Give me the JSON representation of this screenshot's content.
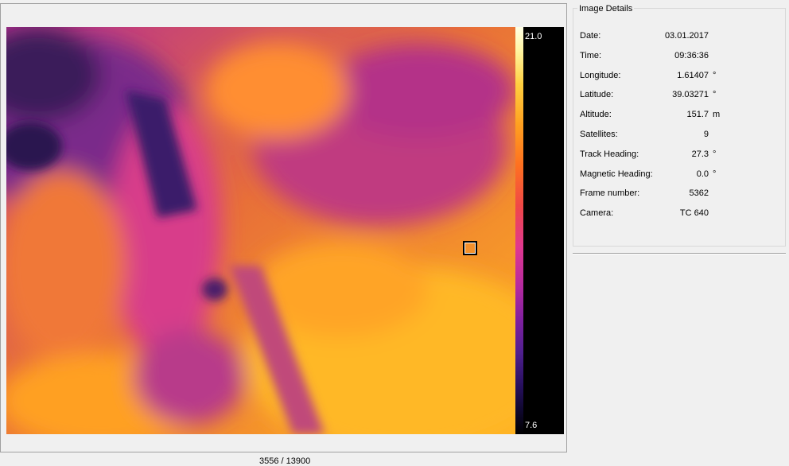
{
  "viewer": {
    "scale": {
      "max": "21.0",
      "min": "7.6"
    },
    "frame_counter": "3556 / 13900"
  },
  "details": {
    "title": "Image Details",
    "rows": [
      {
        "label": "Date:",
        "value": "03.01.2017",
        "unit": ""
      },
      {
        "label": "Time:",
        "value": "09:36:36",
        "unit": ""
      },
      {
        "label": "Longitude:",
        "value": "1.61407",
        "unit": "°"
      },
      {
        "label": "Latitude:",
        "value": "39.03271",
        "unit": "°"
      },
      {
        "label": "Altitude:",
        "value": "151.7",
        "unit": "m"
      },
      {
        "label": "Satellites:",
        "value": "9",
        "unit": ""
      },
      {
        "label": "Track Heading:",
        "value": "27.3",
        "unit": "°"
      },
      {
        "label": "Magnetic Heading:",
        "value": "0.0",
        "unit": "°"
      },
      {
        "label": "Frame number:",
        "value": "5362",
        "unit": ""
      },
      {
        "label": "Camera:",
        "value": "TC 640",
        "unit": ""
      }
    ]
  }
}
